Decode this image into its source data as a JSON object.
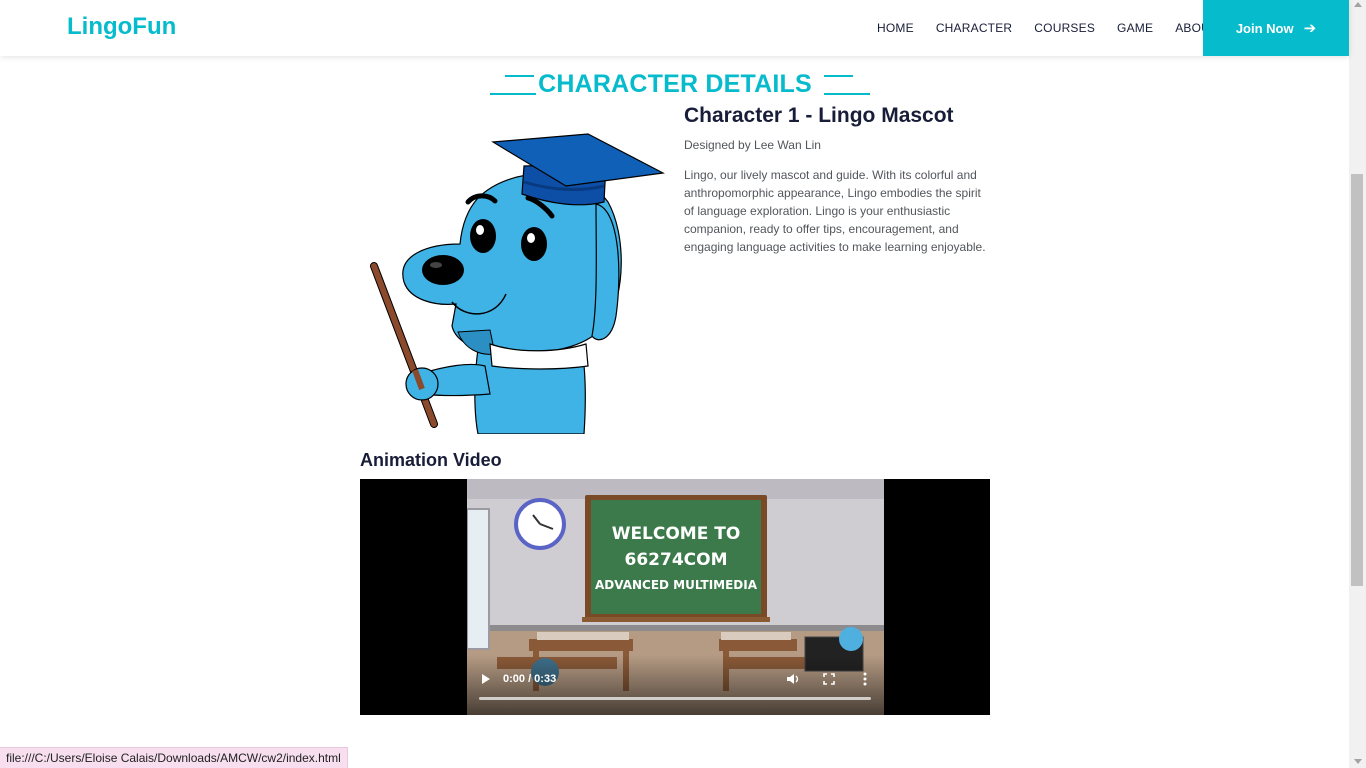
{
  "brand": {
    "name": "LingoFun",
    "icon": "book-icon",
    "color": "#06BBCC"
  },
  "nav": {
    "links": [
      "HOME",
      "CHARACTER",
      "COURSES",
      "GAME",
      "ABOUT"
    ],
    "join_label": "Join Now",
    "join_icon": "arrow-right-icon"
  },
  "section": {
    "title": "CHARACTER DETAILS"
  },
  "character": {
    "title": "Character 1 - Lingo Mascot",
    "designer": "Designed by Lee Wan Lin",
    "description": "Lingo, our lively mascot and guide. With its colorful and anthropomorphic appearance, Lingo embodies the spirit of language exploration. Lingo is your enthusiastic companion, ready to offer tips, encouragement, and engaging language activities to make learning enjoyable."
  },
  "video": {
    "heading": "Animation Video",
    "board_lines": [
      "WELCOME TO",
      "66274COM",
      "ADVANCED MULTIMEDIA"
    ],
    "time": "0:00 / 0:33",
    "progress": 0.0
  },
  "statusbar": {
    "url": "file:///C:/Users/Eloise Calais/Downloads/AMCW/cw2/index.html"
  },
  "colors": {
    "accent": "#06BBCC",
    "heading": "#181d38",
    "mascot": "#3fb3e6",
    "cap": "#1060b8"
  }
}
